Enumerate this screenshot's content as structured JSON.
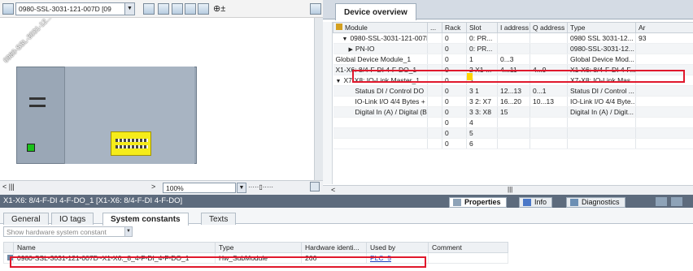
{
  "topology": {
    "device_selector": "0980-SSL-3031-121-007D [09",
    "device_label": "0980-SSL-3031-12...",
    "zoom": "100%"
  },
  "overview": {
    "tab_label": "Device overview",
    "columns": [
      "Module",
      "...",
      "Rack",
      "Slot",
      "I address",
      "Q address",
      "Type",
      "Ar"
    ],
    "rows": [
      {
        "module": "0980-SSL-3031-121-007D",
        "rack": "0",
        "slot": "0: PR...",
        "iaddr": "",
        "qaddr": "",
        "type": "0980 SSL 3031-12...",
        "ar": "93",
        "indent": 1,
        "caret": "▼"
      },
      {
        "module": "PN-IO",
        "rack": "0",
        "slot": "0: PR...",
        "iaddr": "",
        "qaddr": "",
        "type": "0980-SSL-3031-12...",
        "ar": "",
        "indent": 2,
        "caret": "▶"
      },
      {
        "module": "Global Device Module_1",
        "rack": "0",
        "slot": "1",
        "iaddr": "0...3",
        "qaddr": "",
        "type": "Global Device Mod...",
        "ar": "",
        "indent": 0,
        "caret": ""
      },
      {
        "module": "X1-X6: 8/4-F-DI 4-F-DO_1",
        "rack": "0",
        "slot": "2 X1-...",
        "iaddr": "4...11",
        "qaddr": "4...9",
        "type": "X1-X6: 8/4-F-DI 4-F...",
        "ar": "",
        "indent": 0,
        "caret": ""
      },
      {
        "module": "X7-X8: IO-Link Master_1",
        "rack": "0",
        "slot": "3",
        "iaddr": "",
        "qaddr": "",
        "type": "X7-X8: IO-Link Mas...",
        "ar": "",
        "indent": 0,
        "caret": "▼"
      },
      {
        "module": "Status DI / Control DO",
        "rack": "0",
        "slot": "3 1",
        "iaddr": "12...13",
        "qaddr": "0...1",
        "type": "Status DI / Control ...",
        "ar": "",
        "indent": 3,
        "caret": ""
      },
      {
        "module": "IO-Link I/O 4/4 Bytes + P...",
        "rack": "0",
        "slot": "3 2: X7",
        "iaddr": "16...20",
        "qaddr": "10...13",
        "type": "IO-Link I/O 4/4 Byte...",
        "ar": "",
        "indent": 3,
        "caret": ""
      },
      {
        "module": "Digital In (A) / Digital (B)_1",
        "rack": "0",
        "slot": "3 3: X8",
        "iaddr": "15",
        "qaddr": "",
        "type": "Digital In (A) / Digit...",
        "ar": "",
        "indent": 3,
        "caret": ""
      },
      {
        "module": "",
        "rack": "0",
        "slot": "4",
        "iaddr": "",
        "qaddr": "",
        "type": "",
        "ar": "",
        "indent": 0,
        "caret": ""
      },
      {
        "module": "",
        "rack": "0",
        "slot": "5",
        "iaddr": "",
        "qaddr": "",
        "type": "",
        "ar": "",
        "indent": 0,
        "caret": ""
      },
      {
        "module": "",
        "rack": "0",
        "slot": "6",
        "iaddr": "",
        "qaddr": "",
        "type": "",
        "ar": "",
        "indent": 0,
        "caret": ""
      }
    ]
  },
  "inspector": {
    "title": "X1-X6: 8/4-F-DI 4-F-DO_1 [X1-X6: 8/4-F-DI 4-F-DO]",
    "tabs": [
      "Properties",
      "Info",
      "Diagnostics"
    ],
    "subtabs": [
      "General",
      "IO tags",
      "System constants",
      "Texts"
    ],
    "filter": "Show hardware system constant",
    "const_columns": [
      "Name",
      "Type",
      "Hardware identi...",
      "Used by",
      "Comment"
    ],
    "const_rows": [
      {
        "name": "0980-SSL-3031-121-007D~X1-X6:_8_4-F-DI_4-F-DO_1",
        "type": "Hw_SubModule",
        "hwid": "266",
        "used_by": "PLC_5",
        "comment": ""
      }
    ]
  }
}
